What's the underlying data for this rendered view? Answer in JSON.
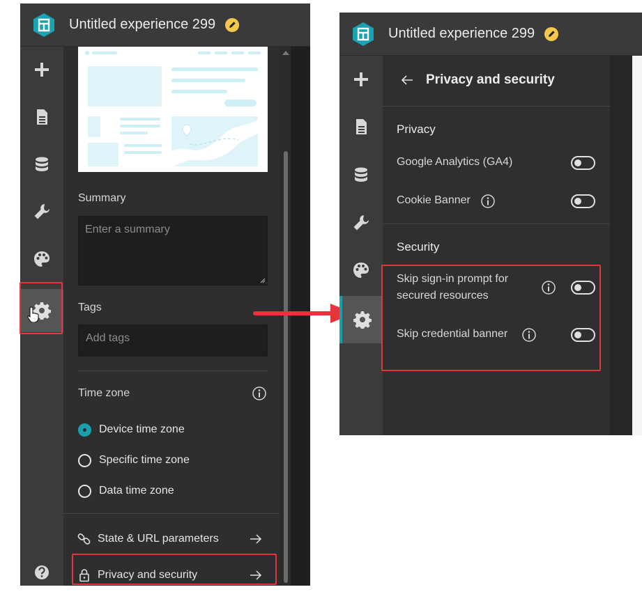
{
  "app": {
    "title": "Untitled experience 299"
  },
  "left_panel": {
    "summary_label": "Summary",
    "summary_placeholder": "Enter a summary",
    "tags_label": "Tags",
    "tags_placeholder": "Add tags",
    "timezone_label": "Time zone",
    "timezone_options": [
      {
        "label": "Device time zone",
        "selected": true
      },
      {
        "label": "Specific time zone",
        "selected": false
      },
      {
        "label": "Data time zone",
        "selected": false
      }
    ],
    "nav_items": [
      {
        "label": "State & URL parameters",
        "icon": "link-icon"
      },
      {
        "label": "Privacy and security",
        "icon": "lock-icon"
      }
    ]
  },
  "right_panel": {
    "back_title": "Privacy and security",
    "privacy_heading": "Privacy",
    "privacy_options": [
      {
        "label": "Google Analytics (GA4)",
        "enabled": false,
        "info": false
      },
      {
        "label": "Cookie Banner",
        "enabled": false,
        "info": true
      }
    ],
    "security_heading": "Security",
    "security_options": [
      {
        "label_line1": "Skip sign-in prompt for",
        "label_line2": "secured resources",
        "enabled": false,
        "info": true
      },
      {
        "label_line1": "Skip credential banner",
        "enabled": false,
        "info": true
      }
    ]
  },
  "rail_icons": [
    "add-icon",
    "page-icon",
    "data-icon",
    "wrench-icon",
    "palette-icon",
    "gear-icon",
    "help-icon"
  ],
  "colors": {
    "accent": "#18a0ad",
    "highlight_red": "#e3353b",
    "edit_badge": "#f5c84c"
  }
}
